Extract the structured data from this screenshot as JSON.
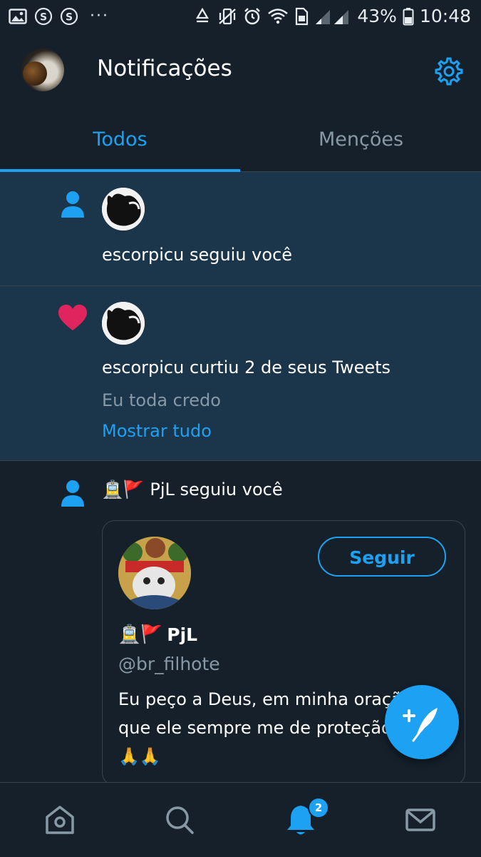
{
  "status_bar": {
    "battery": "43%",
    "time": "10:48",
    "icons": [
      "gallery-icon",
      "s-icon",
      "s-icon",
      "more-dots-icon",
      "recycle-icon",
      "vibrate-icon",
      "alarm-icon",
      "wifi-icon",
      "sim-icon",
      "signal-icon",
      "battery-icon"
    ]
  },
  "header": {
    "title": "Notificações"
  },
  "tabs": [
    {
      "label": "Todos",
      "active": true
    },
    {
      "label": "Menções",
      "active": false
    }
  ],
  "notifications": [
    {
      "type": "follow",
      "icon": "person-icon",
      "text": "escorpicu seguiu você",
      "unread": true
    },
    {
      "type": "like",
      "icon": "heart-icon",
      "text": "escorpicu curtiu 2 de seus Tweets",
      "tweet_preview": "Eu toda credo",
      "show_all": "Mostrar tudo",
      "unread": true
    },
    {
      "type": "follow",
      "icon": "person-icon",
      "text": "🚊🚩 PjL seguiu você",
      "card": {
        "name": "PjL",
        "name_emojis": "🚊🚩",
        "handle": "@br_filhote",
        "follow_label": "Seguir",
        "bio_line1": "Eu peço a Deus, em minha oração",
        "bio_line2": "que ele sempre me de proteção",
        "bio_line3": "🙏🙏"
      }
    }
  ],
  "bottom_nav": {
    "items": [
      "home-icon",
      "search-icon",
      "notifications-icon",
      "messages-icon"
    ],
    "notification_count": "2"
  },
  "colors": {
    "background": "#15202b",
    "unread_background": "#1b364b",
    "accent": "#1da1f2",
    "like": "#e0245e",
    "secondary_text": "#8899a6"
  }
}
